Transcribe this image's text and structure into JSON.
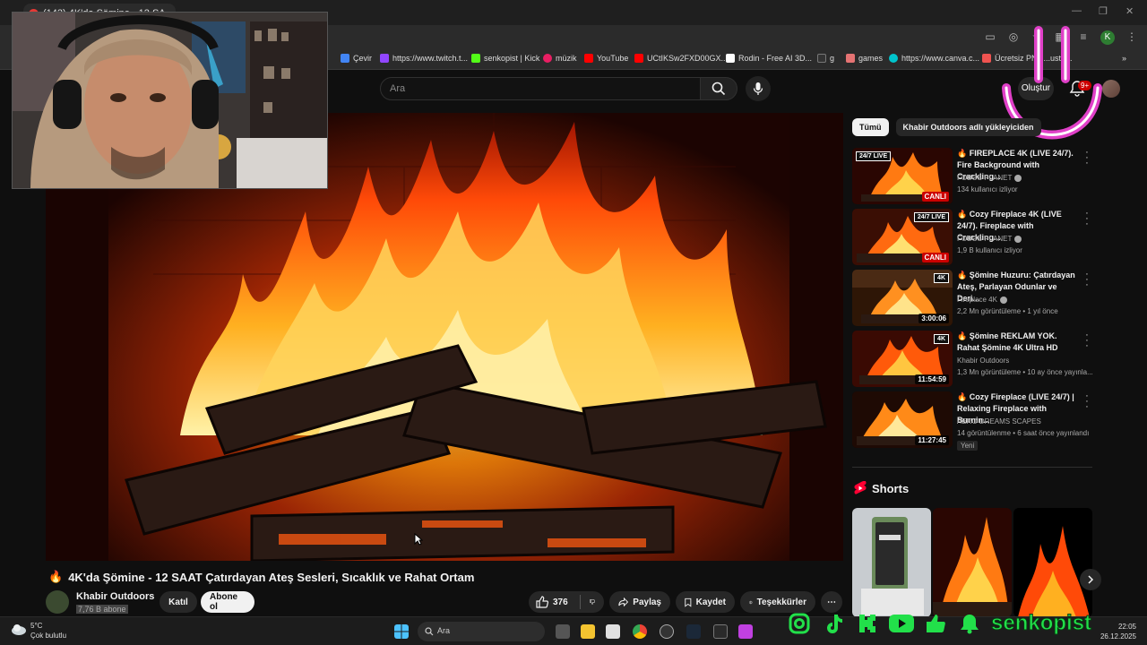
{
  "browser": {
    "tab_title": "(142) 4K'da Şömine - 12 SA...",
    "profile_initial": "K",
    "bookmarks": [
      "Çevir",
      "https://www.twitch.t...",
      "senkopist | Kick",
      "müzik",
      "YouTube",
      "UCtIKSw2FXD00GX...",
      "Rodin - Free AI 3D...",
      "g",
      "games",
      "https://www.canva.c...",
      "Ücretsiz PNG...ustu..."
    ]
  },
  "header": {
    "search_placeholder": "Ara",
    "create_label": "Oluştur",
    "notif_count": "9+"
  },
  "video": {
    "title": "4K'da Şömine - 12 SAAT Çatırdayan Ateş Sesleri, Sıcaklık ve Rahat Ortam",
    "channel": "Khabir Outdoors",
    "subscribers": "7,76 B abone",
    "join_label": "Katıl",
    "subscribe_label": "Abone ol",
    "likes": "376",
    "share_label": "Paylaş",
    "save_label": "Kaydet",
    "thanks_label": "Teşekkürler"
  },
  "sidebar": {
    "chips": [
      "Tümü",
      "Khabir Outdoors adlı yükleyiciden"
    ],
    "recommendations": [
      {
        "title": "🔥 FIREPLACE 4K (LIVE 24/7). Fire Background with Crackling...",
        "channel": "FOBOS PLANET",
        "meta": "134 kullanıcı izliyor",
        "badge": "24/7 LIVE",
        "duration": "CANLI",
        "live": true,
        "verified": true
      },
      {
        "title": "🔥 Cozy Fireplace 4K (LIVE 24/7). Fireplace with Crackling...",
        "channel": "FOBOS PLANET",
        "meta": "1,9 B kullanıcı izliyor",
        "badge": "24/7 LIVE",
        "duration": "CANLI",
        "live": true,
        "verified": true
      },
      {
        "title": "🔥 Şömine Huzuru: Çatırdayan Ateş, Parlayan Odunlar ve Deri...",
        "channel": "Fireplace 4K",
        "meta": "2,2 Mn görüntüleme • 1 yıl önce",
        "badge": "4K",
        "duration": "3:00:06",
        "live": false,
        "verified": true
      },
      {
        "title": "🔥 Şömine REKLAM YOK. Rahat Şömine 4K Ultra HD",
        "channel": "Khabir Outdoors",
        "meta": "1,3 Mn görüntüleme • 10 ay önce yayınla...",
        "badge": "4K",
        "duration": "11:54:59",
        "live": false,
        "verified": false
      },
      {
        "title": "🔥 Cozy Fireplace (LIVE 24/7) | Relaxing Fireplace with Burnin...",
        "channel": "AERO DREAMS SCAPES",
        "meta": "14 görüntülenme • 6 saat önce yayınlandı",
        "badge": "",
        "duration": "11:27:45",
        "live": false,
        "verified": false,
        "new": "Yeni"
      }
    ],
    "shorts_title": "Shorts"
  },
  "taskbar": {
    "temp": "5°C",
    "weather": "Çok bulutlu",
    "search": "Ara",
    "time": "22:05",
    "date": "26.12.2025"
  },
  "overlay": {
    "handle": "senkopist"
  },
  "colors": {
    "accent": "#cc0000",
    "handle": "#22e04a",
    "smile": "#e040c8"
  }
}
